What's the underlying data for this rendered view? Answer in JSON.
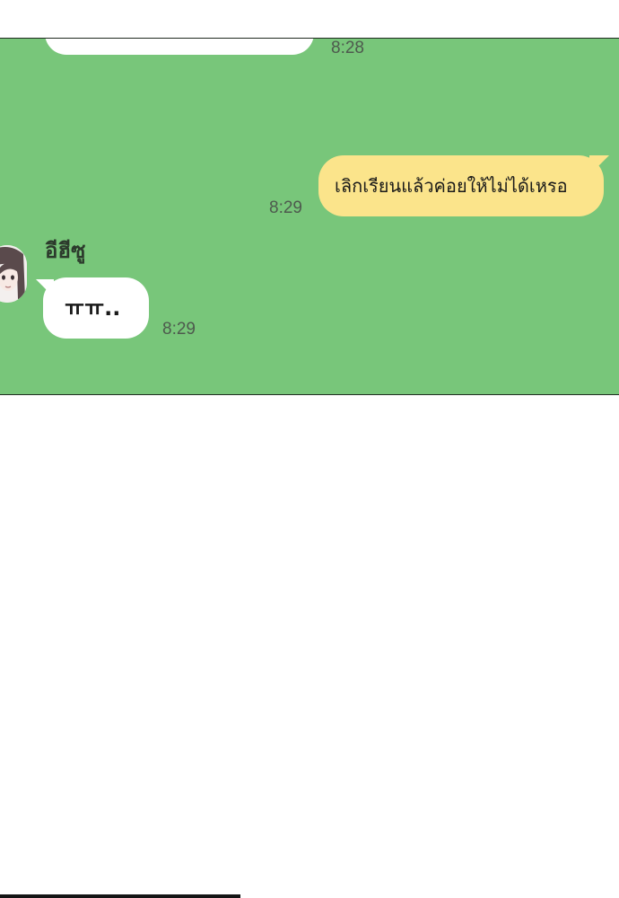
{
  "chat": {
    "previous_message": {
      "text": "",
      "time": "8:28"
    },
    "sent_message": {
      "text": "เลิกเรียนแล้วค่อยให้ไม่ได้เหรอ",
      "time": "8:29"
    },
    "received_message": {
      "sender": "อีฮีซู",
      "text": "ㅠㅠ..",
      "time": "8:29"
    }
  },
  "colors": {
    "chat_background": "#78c67a",
    "sent_bubble": "#fbe48b",
    "received_bubble": "#ffffff",
    "page_background": "#ffffff"
  },
  "icons": {
    "avatar": "sender-avatar"
  }
}
